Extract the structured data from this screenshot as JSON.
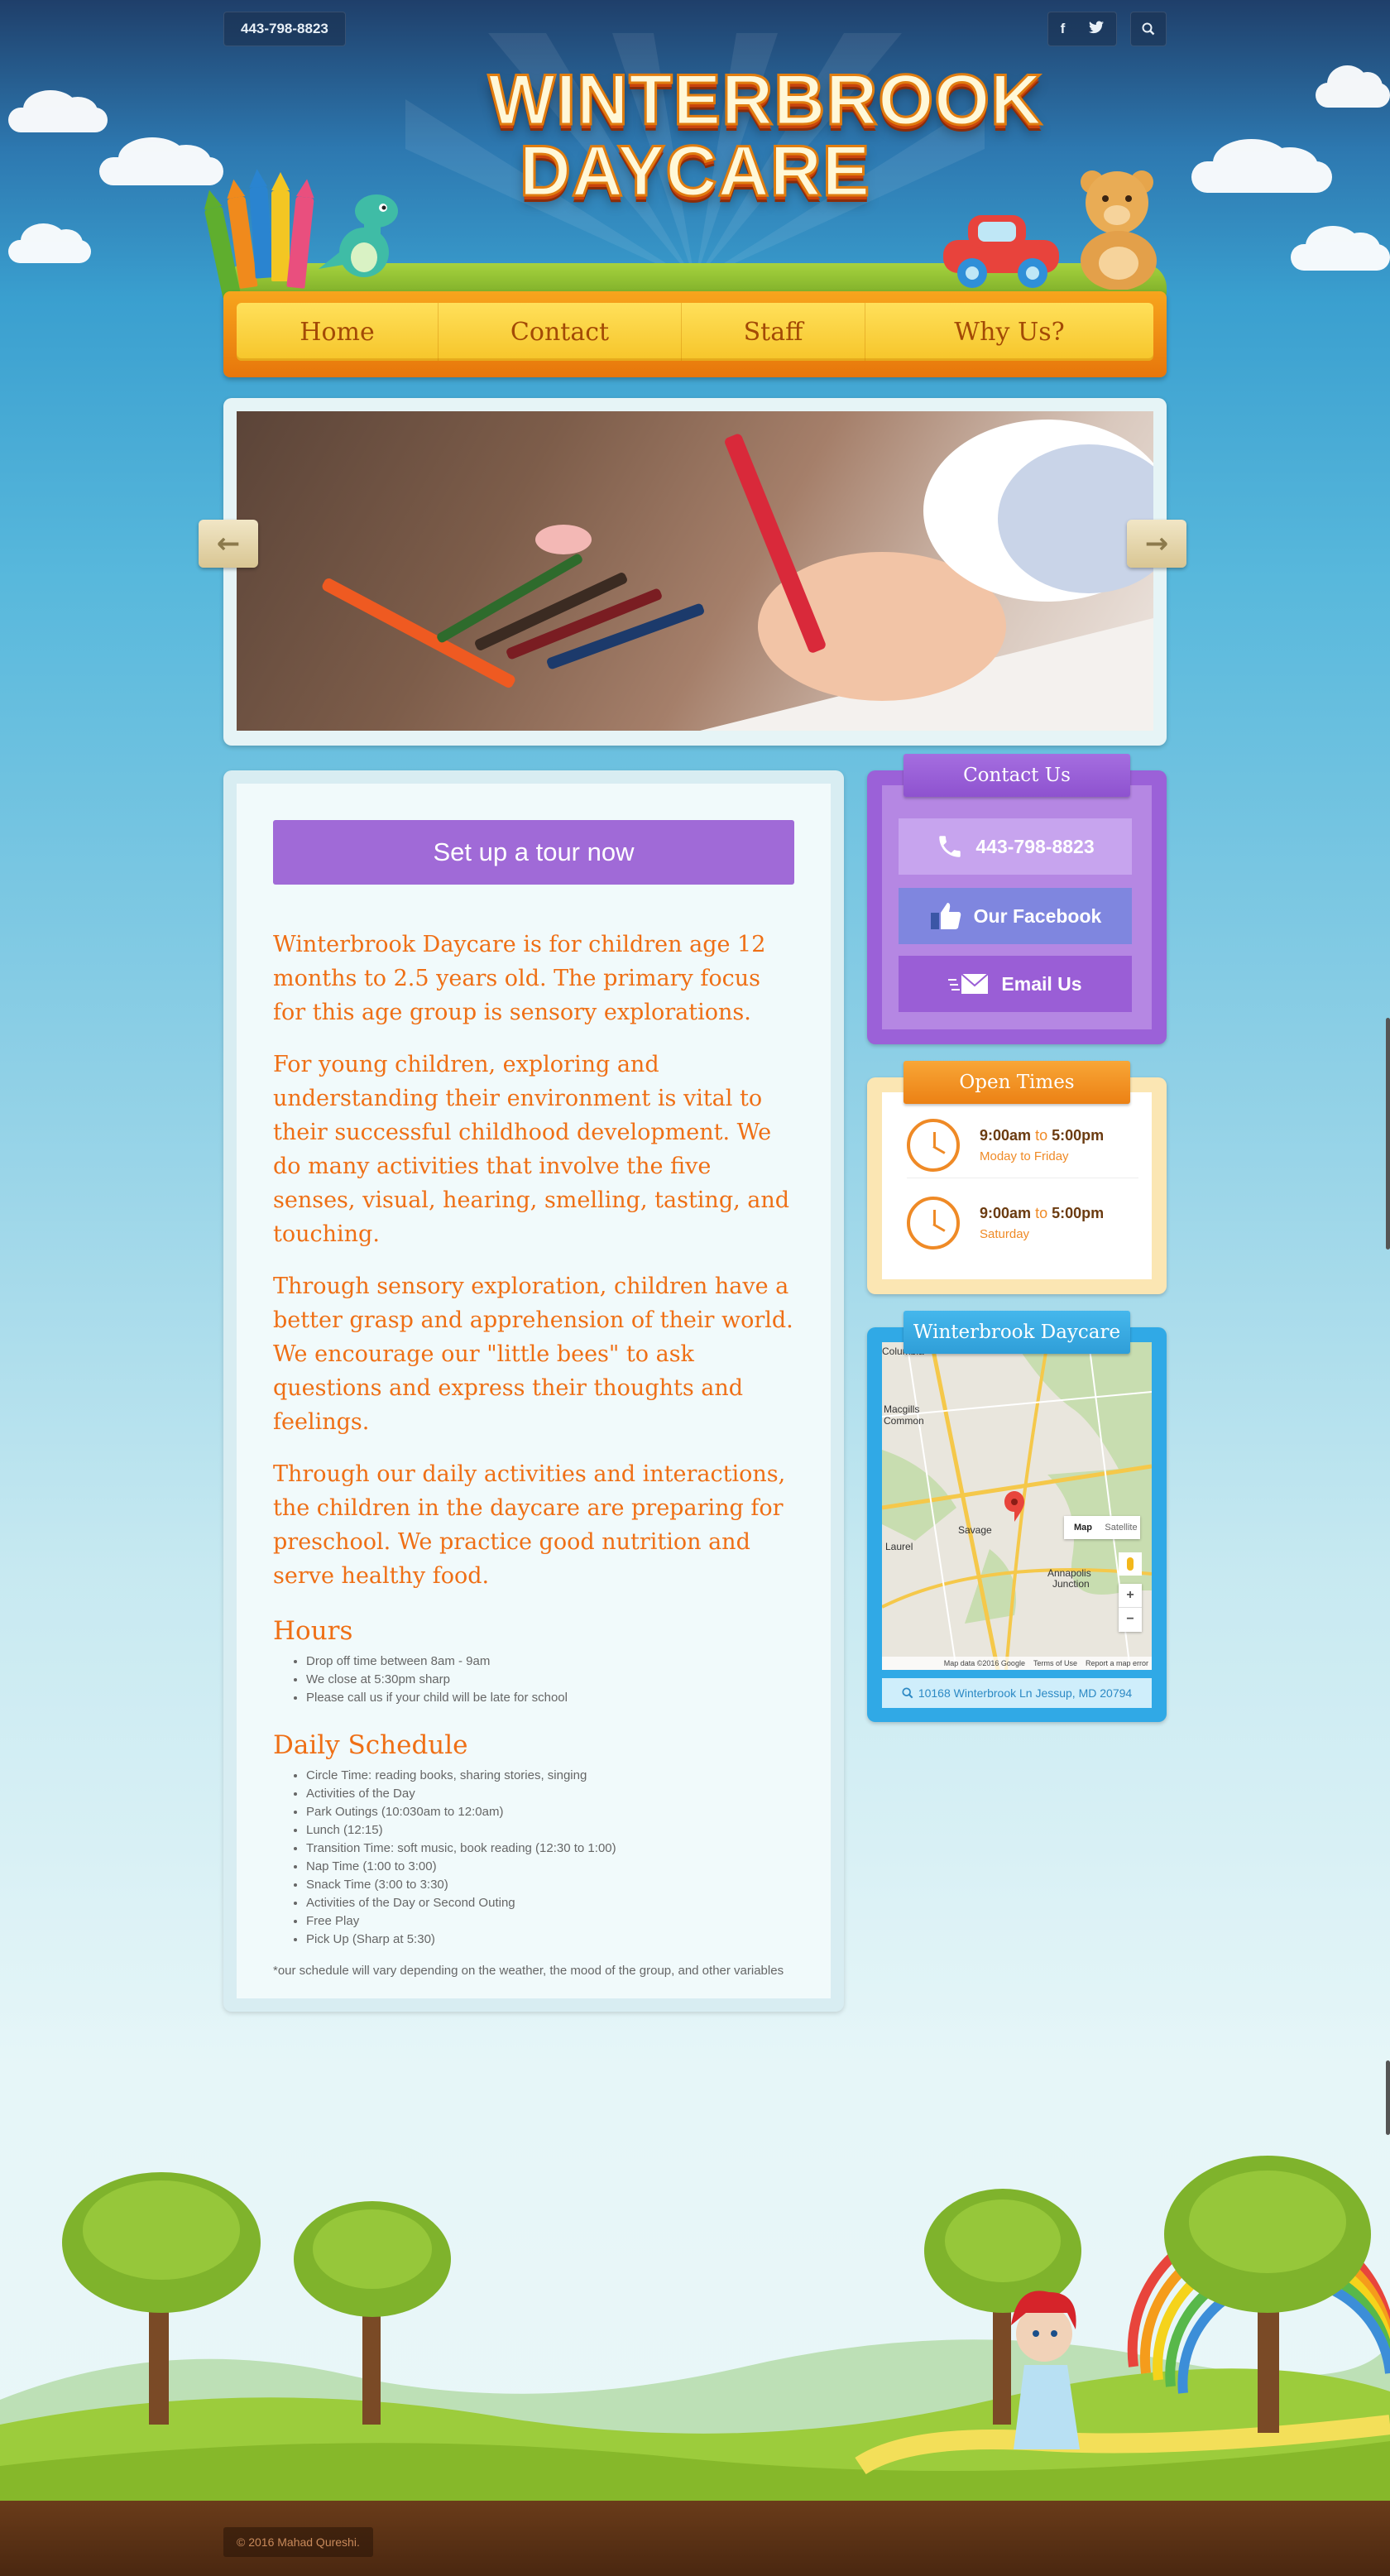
{
  "topbar": {
    "phone": "443-798-8823"
  },
  "logo": {
    "line1": "WINTERBROOK",
    "line2": "DAYCARE"
  },
  "nav": {
    "items": [
      "Home",
      "Contact",
      "Staff",
      "Why Us?"
    ]
  },
  "main": {
    "tour_button": "Set up a tour now",
    "paragraphs": [
      "Winterbrook Daycare is for children age 12 months to 2.5 years old.  The primary focus for this age group is sensory explorations.",
      "For young children, exploring and understanding their environment is vital to their successful childhood development.  We do many activities that involve the five senses, visual, hearing, smelling, tasting, and touching.",
      "Through sensory exploration, children have a better grasp and apprehension of their world.  We encourage our \"little bees\" to ask questions and express their thoughts and feelings.",
      "Through our daily activities and interactions, the children in the daycare are preparing for preschool.  We practice good nutrition and serve healthy food."
    ],
    "hours_heading": "Hours",
    "hours_items": [
      "Drop off time between 8am - 9am",
      "We close at 5:30pm sharp",
      "Please call us if your child will be late for school"
    ],
    "schedule_heading": "Daily Schedule",
    "schedule_items": [
      "Circle Time: reading books, sharing stories, singing",
      "Activities of the Day",
      "Park Outings (10:030am to 12:0am)",
      "Lunch (12:15)",
      "Transition Time: soft music, book reading (12:30 to 1:00)",
      "Nap Time (1:00 to 3:00)",
      "Snack Time (3:00 to 3:30)",
      "Activities of the Day or Second Outing",
      "Free Play",
      "Pick Up (Sharp at 5:30)"
    ],
    "note": "*our schedule will vary depending on the weather, the mood of the group, and other variables"
  },
  "contact_widget": {
    "title": "Contact Us",
    "phone_label": "443-798-8823",
    "facebook_label": "Our Facebook",
    "email_label": "Email Us"
  },
  "open_widget": {
    "title": "Open Times",
    "rows": [
      {
        "from": "9:00am",
        "to_word": "to",
        "until": "5:00pm",
        "days": "Moday to Friday"
      },
      {
        "from": "9:00am",
        "to_word": "to",
        "until": "5:00pm",
        "days": "Saturday"
      }
    ]
  },
  "map_widget": {
    "title": "Winterbrook Daycare",
    "labels": {
      "columbia": "Columbia",
      "macgills": "Macgills",
      "common": "Common",
      "savage": "Savage",
      "laurel": "Laurel",
      "annapolis": "Annapolis",
      "junction": "Junction"
    },
    "map_type": "Map",
    "satellite_type": "Satellite",
    "zoom_in": "+",
    "zoom_out": "−",
    "attribution": "Map data ©2016 Google",
    "terms": "Terms of Use",
    "report": "Report a map error",
    "address": "10168 Winterbrook Ln Jessup, MD 20794"
  },
  "footer": {
    "copyright": "© 2016 Mahad Qureshi."
  },
  "colors": {
    "orange_text": "#ef6f15",
    "purple": "#9b61d8",
    "nav_yellow": "#ffe05a",
    "map_blue": "#30a9e6"
  }
}
